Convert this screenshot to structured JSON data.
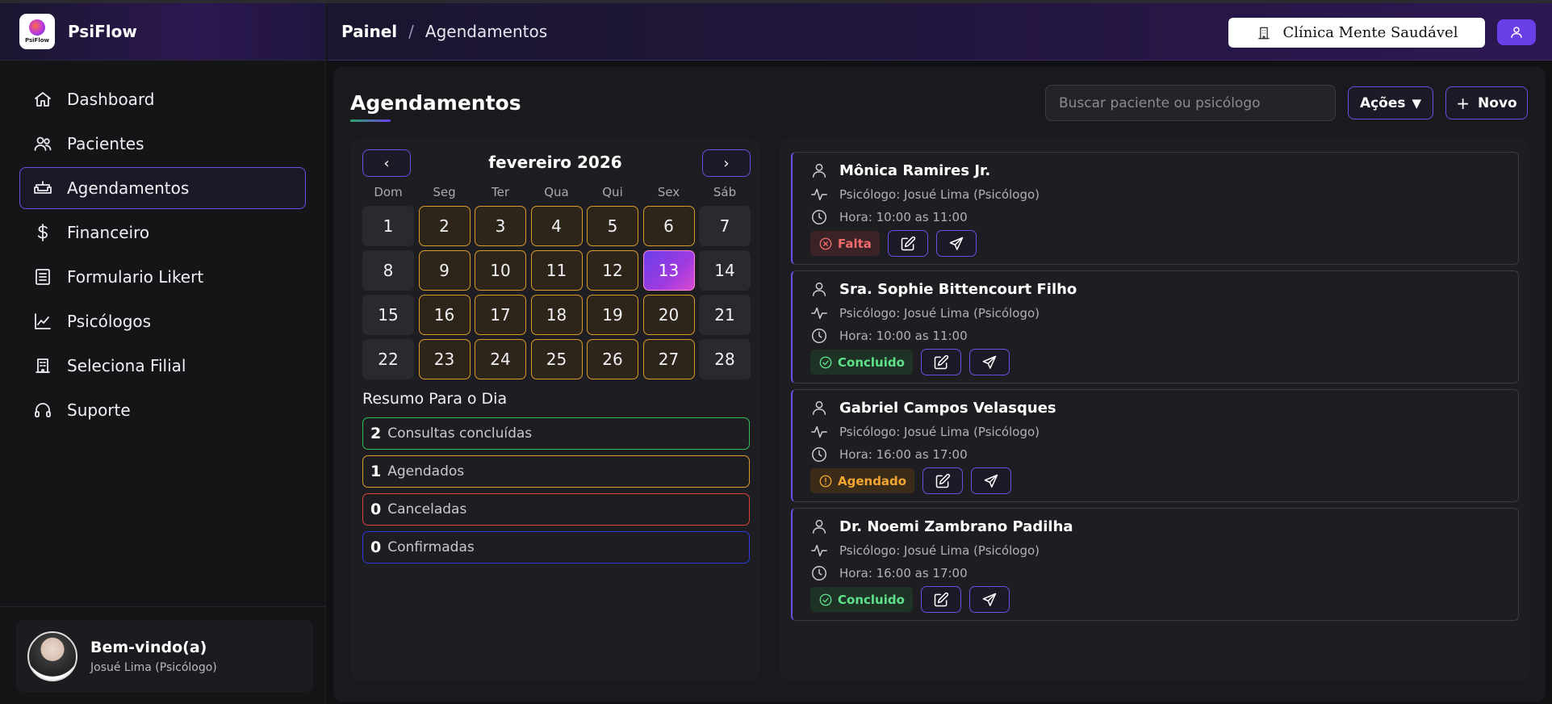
{
  "brand": {
    "name": "PsiFlow",
    "logo_text": "PsiFlow"
  },
  "sidebar": {
    "items": [
      {
        "label": "Dashboard",
        "icon": "home-icon"
      },
      {
        "label": "Pacientes",
        "icon": "users-icon"
      },
      {
        "label": "Agendamentos",
        "icon": "couch-icon",
        "active": true
      },
      {
        "label": "Financeiro",
        "icon": "dollar-icon"
      },
      {
        "label": "Formulario Likert",
        "icon": "form-icon"
      },
      {
        "label": "Psicólogos",
        "icon": "chart-icon"
      },
      {
        "label": "Seleciona Filial",
        "icon": "building-icon"
      },
      {
        "label": "Suporte",
        "icon": "headset-icon"
      }
    ],
    "welcome": {
      "title": "Bem-vindo(a)",
      "user": "Josué Lima (Psicólogo)"
    }
  },
  "header": {
    "breadcrumb": {
      "root": "Painel",
      "separator": "/",
      "current": "Agendamentos"
    },
    "clinic": "Clínica Mente Saudável"
  },
  "main": {
    "title": "Agendamentos",
    "search_placeholder": "Buscar paciente ou psicólogo",
    "actions_label": "Ações",
    "actions_caret": "▼",
    "new_label": "Novo",
    "new_plus": "+"
  },
  "calendar": {
    "prev": "‹",
    "next": "›",
    "month": "fevereiro 2026",
    "weekdays": [
      "Dom",
      "Seg",
      "Ter",
      "Qua",
      "Qui",
      "Sex",
      "Sáb"
    ],
    "days": [
      {
        "n": "1",
        "s": ""
      },
      {
        "n": "2",
        "s": "has"
      },
      {
        "n": "3",
        "s": "has"
      },
      {
        "n": "4",
        "s": "has"
      },
      {
        "n": "5",
        "s": "has"
      },
      {
        "n": "6",
        "s": "has"
      },
      {
        "n": "7",
        "s": ""
      },
      {
        "n": "8",
        "s": ""
      },
      {
        "n": "9",
        "s": "has"
      },
      {
        "n": "10",
        "s": "has"
      },
      {
        "n": "11",
        "s": "has"
      },
      {
        "n": "12",
        "s": "has"
      },
      {
        "n": "13",
        "s": "today"
      },
      {
        "n": "14",
        "s": ""
      },
      {
        "n": "15",
        "s": ""
      },
      {
        "n": "16",
        "s": "has"
      },
      {
        "n": "17",
        "s": "has"
      },
      {
        "n": "18",
        "s": "has"
      },
      {
        "n": "19",
        "s": "has"
      },
      {
        "n": "20",
        "s": "has"
      },
      {
        "n": "21",
        "s": ""
      },
      {
        "n": "22",
        "s": ""
      },
      {
        "n": "23",
        "s": "has"
      },
      {
        "n": "24",
        "s": "has"
      },
      {
        "n": "25",
        "s": "has"
      },
      {
        "n": "26",
        "s": "has"
      },
      {
        "n": "27",
        "s": "has"
      },
      {
        "n": "28",
        "s": ""
      }
    ],
    "colors": {
      "has_border": "#d99a2c",
      "today_start": "#6a3fe8",
      "today_end": "#d94bd0"
    }
  },
  "summary": {
    "title": "Resumo Para o Dia",
    "items": [
      {
        "count": "2",
        "label": "Consultas concluídas",
        "color": "#2fbf5a"
      },
      {
        "count": "1",
        "label": "Agendados",
        "color": "#d99a2c"
      },
      {
        "count": "0",
        "label": "Canceladas",
        "color": "#d8443a"
      },
      {
        "count": "0",
        "label": "Confirmadas",
        "color": "#2a3ad8"
      }
    ]
  },
  "appointments": [
    {
      "patient": "Mônica Ramires Jr.",
      "psychologist": "Psicólogo: Josué Lima (Psicólogo)",
      "time": "Hora: 10:00 as 11:00",
      "status": "Falta",
      "status_key": "falta"
    },
    {
      "patient": "Sra. Sophie Bittencourt Filho",
      "psychologist": "Psicólogo: Josué Lima (Psicólogo)",
      "time": "Hora: 10:00 as 11:00",
      "status": "Concluido",
      "status_key": "concluido"
    },
    {
      "patient": "Gabriel Campos Velasques",
      "psychologist": "Psicólogo: Josué Lima (Psicólogo)",
      "time": "Hora: 16:00 as 17:00",
      "status": "Agendado",
      "status_key": "agendado"
    },
    {
      "patient": "Dr. Noemi Zambrano Padilha",
      "psychologist": "Psicólogo: Josué Lima (Psicólogo)",
      "time": "Hora: 16:00 as 17:00",
      "status": "Concluido",
      "status_key": "concluido"
    }
  ],
  "theme": {
    "accent": "#6a3fe8",
    "accent_border": "#6a4fe0",
    "background": "#111114"
  }
}
